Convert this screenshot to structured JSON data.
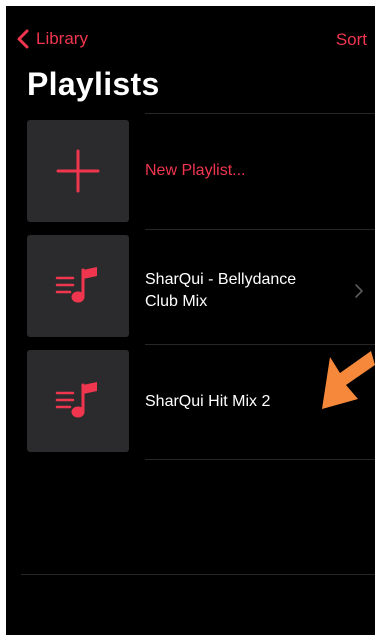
{
  "nav": {
    "back_label": "Library",
    "sort_label": "Sort"
  },
  "header": {
    "title": "Playlists"
  },
  "playlists": [
    {
      "label": "New Playlist...",
      "icon": "plus-icon",
      "accent": true
    },
    {
      "label": "SharQui - Bellydance Club Mix",
      "icon": "music-list-icon",
      "has_chevron": true
    },
    {
      "label": "SharQui Hit Mix 2",
      "icon": "music-list-icon"
    }
  ],
  "colors": {
    "accent": "#f0364f",
    "background": "#000000",
    "artwork_bg": "#2b2b2d",
    "annotation_arrow": "#f5883a"
  }
}
